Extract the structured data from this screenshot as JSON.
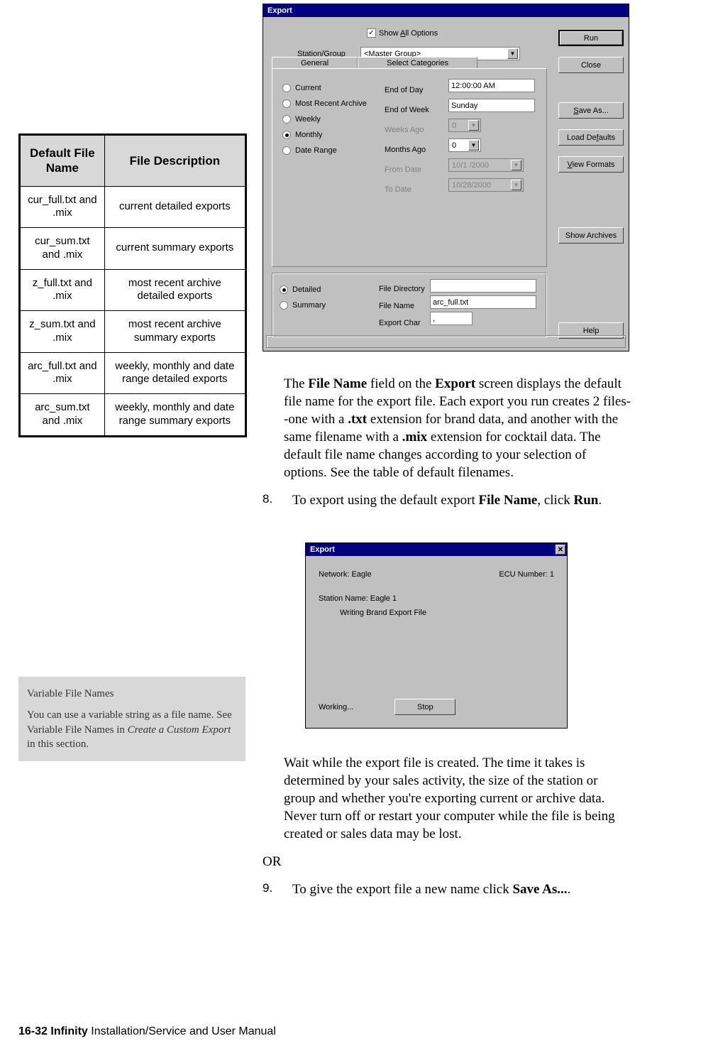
{
  "export_dialog": {
    "title": "Export",
    "show_all_label": "Show All Options",
    "show_all_underline": "A",
    "station_label": "Station/Group",
    "station_value": "<Master Group>",
    "buttons": {
      "run": "Run",
      "close": "Close",
      "saveas": "Save As...",
      "loaddef": "Load Defaults",
      "viewfmt": "View Formats",
      "showarc": "Show Archives",
      "help": "Help"
    },
    "tabs": {
      "general": "General",
      "select": "Select Categories"
    },
    "radios": {
      "current": "Current",
      "recent": "Most Recent Archive",
      "weekly": "Weekly",
      "monthly": "Monthly",
      "range": "Date Range"
    },
    "params": {
      "eod": "End of Day",
      "eod_val": "12:00:00 AM",
      "eow": "End of Week",
      "eow_val": "Sunday",
      "weeks": "Weeks Ago",
      "weeks_val": "0",
      "months": "Months Ago",
      "months_val": "0",
      "from": "From Date",
      "from_val": "10/1 /2000",
      "to": "To Date",
      "to_val": "10/28/2000"
    },
    "bottom": {
      "detailed": "Detailed",
      "summary": "Summary",
      "dir": "File Directory",
      "dir_val": "",
      "fname": "File Name",
      "fname_val": "arc_full.txt",
      "char": "Export Char",
      "char_val": ","
    }
  },
  "fn_table": {
    "h1": "Default File Name",
    "h2": "File Description",
    "rows": [
      {
        "a": "cur_full.txt and .mix",
        "b": "current detailed exports"
      },
      {
        "a": "cur_sum.txt and .mix",
        "b": "current summary exports"
      },
      {
        "a": "z_full.txt and .mix",
        "b": "most recent archive detailed exports"
      },
      {
        "a": "z_sum.txt and .mix",
        "b": "most recent archive summary exports"
      },
      {
        "a": "arc_full.txt and .mix",
        "b": "weekly, monthly and date range detailed exports"
      },
      {
        "a": "arc_sum.txt and .mix",
        "b": "weekly, monthly and date range summary exports"
      }
    ]
  },
  "note": {
    "title": "Variable File Names",
    "body_a": "You can use a variable string as a file name. See Variable File Names in ",
    "body_em": "Create a Custom Export",
    "body_b": " in this section."
  },
  "body": {
    "p1_a": "The ",
    "p1_b1": "File Name",
    "p1_c": " field on the ",
    "p1_b2": "Export",
    "p1_d": " screen displays the default file name for the export file. Each export you run creates 2 files--one with a ",
    "p1_b3": ".txt",
    "p1_e": " extension for brand data, and another with the same filename with a ",
    "p1_b4": ".mix",
    "p1_f": " extension for cocktail data. The default file name changes according to your selection of options. See the table of default filenames.",
    "step8_n": "8.",
    "step8_a": "To export using the default export ",
    "step8_b1": "File Name",
    "step8_c": ", click ",
    "step8_b2": "Run",
    "step8_d": ".",
    "p3": "Wait while the export file is created. The time it takes is determined by your sales activity, the size of the station or group and whether you're exporting current or archive data. Never turn off or restart your computer while the file is being created or sales data may be lost.",
    "or": "OR",
    "step9_n": "9.",
    "step9_a": "To give the export file a new name click ",
    "step9_b": "Save As...",
    "step9_c": "."
  },
  "prog": {
    "title": "Export",
    "net_l": "Network: Eagle",
    "ecu_l": "ECU Number: 1",
    "station": "Station Name: Eagle 1",
    "msg": "Writing Brand Export File",
    "working": "Working...",
    "stop": "Stop"
  },
  "footer": {
    "a": "16-32  Infinity",
    "b": " Installation/Service and User Manual"
  }
}
